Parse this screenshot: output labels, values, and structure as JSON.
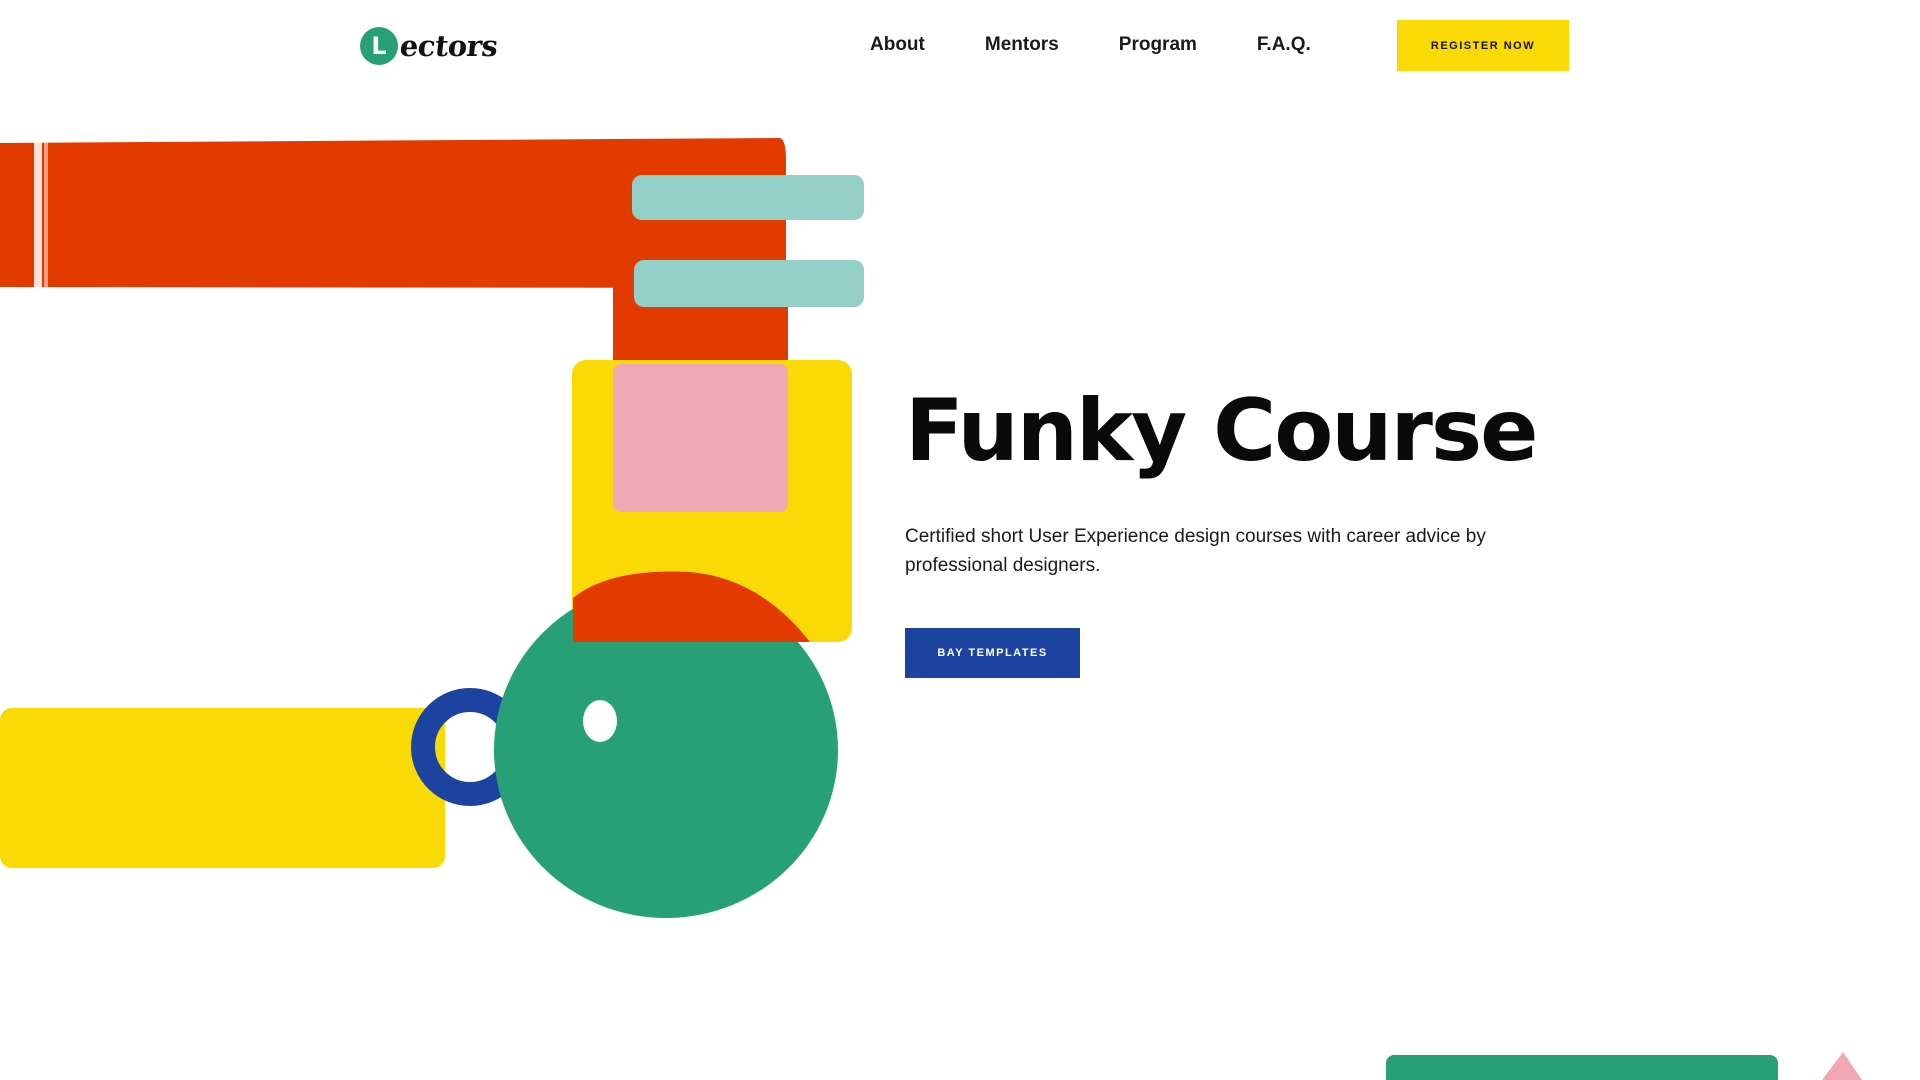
{
  "logo": {
    "badge_letter": "L",
    "text": "ectors"
  },
  "nav": {
    "items": [
      {
        "label": "About"
      },
      {
        "label": "Mentors"
      },
      {
        "label": "Program"
      },
      {
        "label": "F.A.Q."
      }
    ],
    "cta_label": "REGISTER NOW"
  },
  "hero": {
    "title": "Funky Course",
    "description": "Certified short User Experience design courses with career advice by professional designers.",
    "button_label": "BAY TEMPLATES"
  },
  "colors": {
    "red": "#e33a00",
    "yellow": "#f9da06",
    "green": "#27a077",
    "blue": "#1b439f",
    "mint": "#94cfc8",
    "pink": "#f0a8b7"
  }
}
